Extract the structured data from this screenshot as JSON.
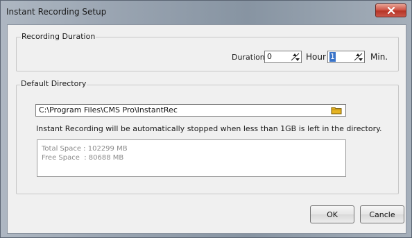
{
  "window": {
    "title": "Instant Recording Setup"
  },
  "recording_duration": {
    "group_label": "Recording Duration",
    "duration_label": "Duration",
    "hour_value": "0",
    "hour_label": "Hour",
    "minute_value": "1",
    "minute_label": "Min."
  },
  "default_directory": {
    "group_label": "Default Directory",
    "path": "C:\\Program Files\\CMS Pro\\InstantRec",
    "note": "Instant Recording will be automatically stopped when less than 1GB is left in the directory.",
    "total_space": "Total Space : 102299 MB",
    "free_space": "Free Space  : 80688 MB"
  },
  "buttons": {
    "ok": "OK",
    "cancel": "Cancle"
  },
  "icons": {
    "close": "close-icon",
    "spin_up_down": "spin-arrows-icon",
    "folder": "folder-icon"
  },
  "colors": {
    "selection": "#3a74c9",
    "close_button": "#c9473a"
  }
}
